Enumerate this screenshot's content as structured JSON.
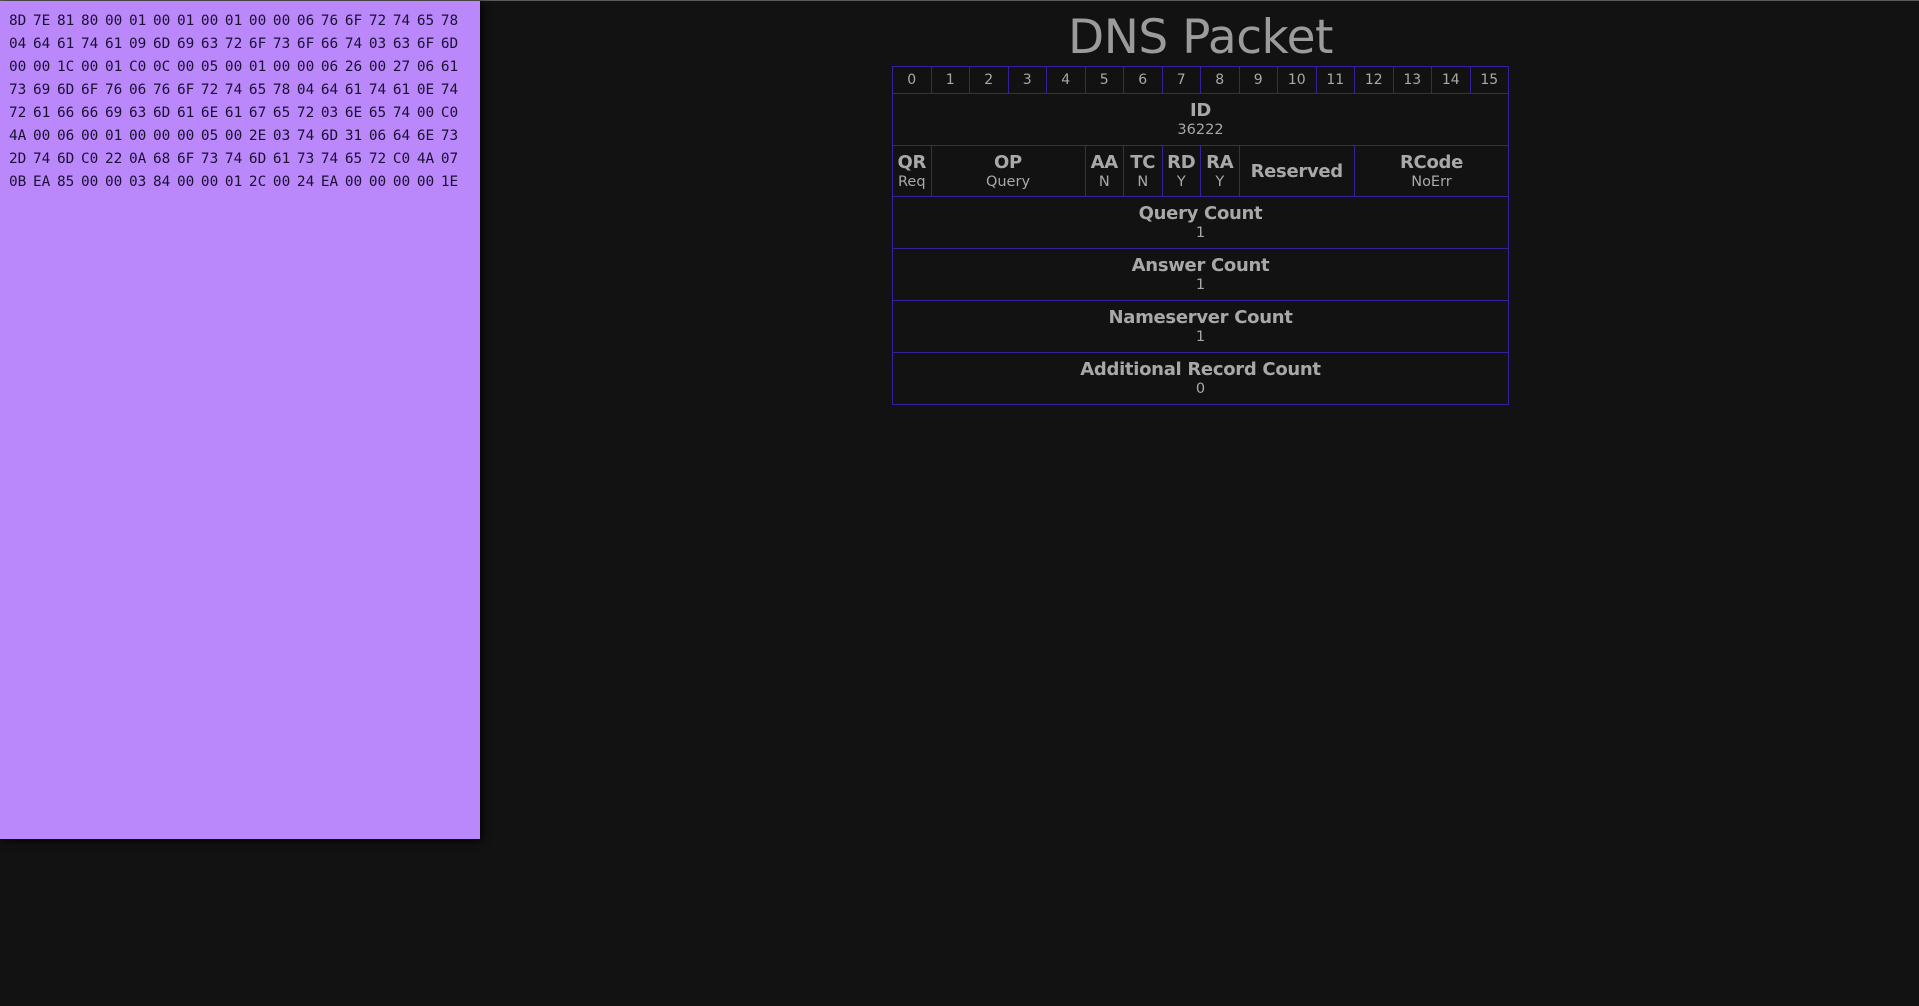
{
  "hex_dump": "8D 7E 81 80 00 01 00 01 00 01 00 00 06 76 6F 72 74 65 78 04 64 61 74 61 09 6D 69 63 72 6F 73 6F 66 74 03 63 6F 6D 00 00 1C 00 01 C0 0C 00 05 00 01 00 00 06 26 00 27 06 61 73 69 6D 6F 76 06 76 6F 72 74 65 78 04 64 61 74 61 0E 74 72 61 66 66 69 63 6D 61 6E 61 67 65 72 03 6E 65 74 00 C0 4A 00 06 00 01 00 00 00 05 00 2E 03 74 6D 31 06 64 6E 73 2D 74 6D C0 22 0A 68 6F 73 74 6D 61 73 74 65 72 C0 4A 07 0B EA 85 00 00 03 84 00 00 01 2C 00 24 EA 00 00 00 00 1E",
  "title": "DNS Packet",
  "bits": [
    "0",
    "1",
    "2",
    "3",
    "4",
    "5",
    "6",
    "7",
    "8",
    "9",
    "10",
    "11",
    "12",
    "13",
    "14",
    "15"
  ],
  "fields": {
    "id": {
      "name": "ID",
      "value": "36222"
    },
    "qr": {
      "name": "QR",
      "value": "Req"
    },
    "op": {
      "name": "OP",
      "value": "Query"
    },
    "aa": {
      "name": "AA",
      "value": "N"
    },
    "tc": {
      "name": "TC",
      "value": "N"
    },
    "rd": {
      "name": "RD",
      "value": "Y"
    },
    "ra": {
      "name": "RA",
      "value": "Y"
    },
    "reserved": {
      "name": "Reserved"
    },
    "rcode": {
      "name": "RCode",
      "value": "NoErr"
    },
    "query_count": {
      "name": "Query Count",
      "value": "1"
    },
    "answer_count": {
      "name": "Answer Count",
      "value": "1"
    },
    "nameserver_count": {
      "name": "Nameserver Count",
      "value": "1"
    },
    "additional_count": {
      "name": "Additional Record Count",
      "value": "0"
    }
  },
  "colors": {
    "panel": "#bb88fc",
    "background": "#121212",
    "grid_border": "#3a1f9c",
    "text": "#a8a8a8"
  }
}
